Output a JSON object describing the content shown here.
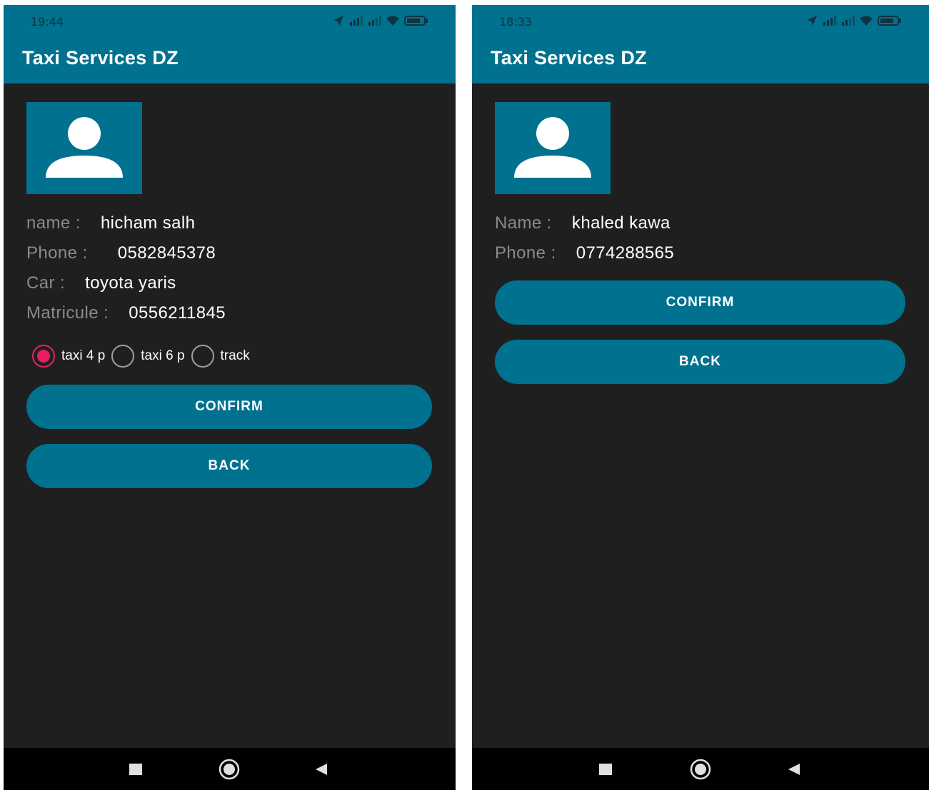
{
  "screens": [
    {
      "status_time": "19:44",
      "title": "Taxi Services DZ",
      "fields": [
        {
          "label": "name :",
          "value": "hicham salh"
        },
        {
          "label": "Phone :",
          "value": "0582845378"
        },
        {
          "label": "Car :",
          "value": "toyota yaris"
        },
        {
          "label": "Matricule :",
          "value": "0556211845"
        }
      ],
      "vehicle_options": [
        {
          "label": "taxi 4 p",
          "selected": true
        },
        {
          "label": "taxi 6 p",
          "selected": false
        },
        {
          "label": "track",
          "selected": false
        }
      ],
      "confirm_label": "CONFIRM",
      "back_label": "BACK"
    },
    {
      "status_time": "18:33",
      "title": "Taxi Services DZ",
      "fields": [
        {
          "label": "Name :",
          "value": "khaled kawa"
        },
        {
          "label": "Phone :",
          "value": "0774288565"
        }
      ],
      "confirm_label": "CONFIRM",
      "back_label": "BACK"
    }
  ],
  "icons": {
    "status": [
      "location-icon",
      "signal-icon",
      "signal-icon",
      "wifi-icon",
      "battery-icon"
    ],
    "avatar": "user-avatar-icon",
    "nav": [
      "recent-apps-icon",
      "home-icon",
      "back-icon"
    ]
  },
  "colors": {
    "primary": "#00718f",
    "background": "#1f1f1f",
    "label": "#8a8a8a",
    "value": "#ffffff",
    "radio_selected": "#e91e63",
    "nav_bar": "#000000"
  }
}
